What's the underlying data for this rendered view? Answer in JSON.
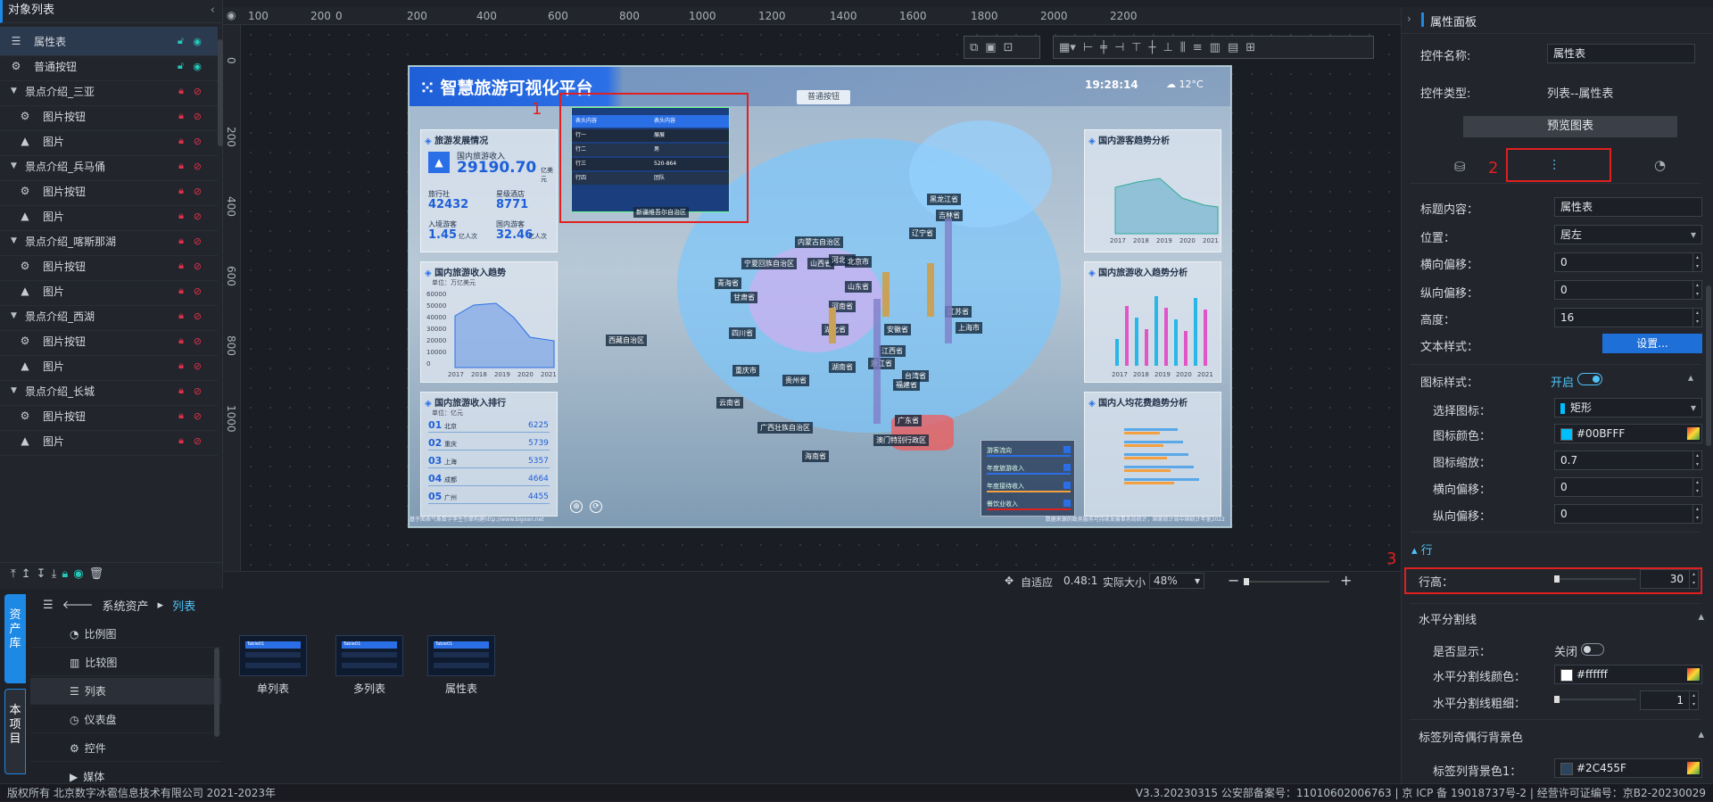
{
  "left_panel": {
    "title": "对象列表",
    "items": [
      {
        "label": "属性表",
        "type": "table",
        "lock": "unlocked",
        "eye": "visible",
        "indent": 0,
        "selected": true
      },
      {
        "label": "普通按钮",
        "type": "gear",
        "lock": "unlocked",
        "eye": "visible",
        "indent": 0
      },
      {
        "label": "景点介绍_三亚",
        "type": "group",
        "indent": 0
      },
      {
        "label": "图片按钮",
        "type": "gear",
        "indent": 1
      },
      {
        "label": "图片",
        "type": "image",
        "indent": 1
      },
      {
        "label": "景点介绍_兵马俑",
        "type": "group",
        "indent": 0
      },
      {
        "label": "图片按钮",
        "type": "gear",
        "indent": 1
      },
      {
        "label": "图片",
        "type": "image",
        "indent": 1
      },
      {
        "label": "景点介绍_喀斯那湖",
        "type": "group",
        "indent": 0
      },
      {
        "label": "图片按钮",
        "type": "gear",
        "indent": 1
      },
      {
        "label": "图片",
        "type": "image",
        "indent": 1
      },
      {
        "label": "景点介绍_西湖",
        "type": "group",
        "indent": 0
      },
      {
        "label": "图片按钮",
        "type": "gear",
        "indent": 1
      },
      {
        "label": "图片",
        "type": "image",
        "indent": 1
      },
      {
        "label": "景点介绍_长城",
        "type": "group",
        "indent": 0
      },
      {
        "label": "图片按钮",
        "type": "gear",
        "indent": 1
      },
      {
        "label": "图片",
        "type": "image",
        "indent": 1
      }
    ]
  },
  "ruler": {
    "top": [
      "100",
      "200",
      "0",
      "200",
      "400",
      "600",
      "800",
      "1000",
      "1200",
      "1400",
      "1600",
      "1800",
      "2000",
      "2200"
    ],
    "left": [
      "0",
      "200",
      "400",
      "600",
      "800",
      "1000"
    ]
  },
  "dashboard": {
    "title": "智慧旅游可视化平台",
    "clock": "19:28:14",
    "weather": "12°C",
    "pill": "普通按钮",
    "cards": {
      "dev": "旅游发展情况",
      "income_label": "国内旅游收入",
      "income": "29190.70",
      "income_unit": "亿美元",
      "k1_label": "旅行社",
      "k1": "42432",
      "k2_label": "星级酒店",
      "k2": "8771",
      "k3_label": "入境游客",
      "k3": "1.45",
      "k3_unit": "亿人次",
      "k4_label": "国内游客",
      "k4": "32.46",
      "k4_unit": "亿人次",
      "trend": "国内旅游收入趋势",
      "trend_unit": "单位：万亿美元",
      "rank": "国内旅游收入排行",
      "rank_unit": "单位：亿元",
      "rank_items": [
        {
          "n": "01",
          "c": "北京",
          "v": "6225"
        },
        {
          "n": "02",
          "c": "重庆",
          "v": "5739"
        },
        {
          "n": "03",
          "c": "上海",
          "v": "5357"
        },
        {
          "n": "04",
          "c": "成都",
          "v": "4664"
        },
        {
          "n": "05",
          "c": "广州",
          "v": "4455"
        }
      ],
      "r1": "国内游客趋势分析",
      "r2": "国内旅游收入趋势分析",
      "r3": "国内人均花费趋势分析",
      "legend_items": [
        "游客流向",
        "年度旅游收入",
        "年度接待收入",
        "餐饮业收入"
      ]
    },
    "years": [
      "2017",
      "2018",
      "2019",
      "2020",
      "2021"
    ],
    "income_trend_yticks": [
      "60000",
      "50000",
      "40000",
      "30000",
      "20000",
      "10000",
      "0"
    ],
    "map_labels": [
      "西藏自治区",
      "四川省",
      "重庆市",
      "云南省",
      "青海省",
      "甘肃省",
      "宁夏回族自治区",
      "内蒙古自治区",
      "山西省",
      "河北省",
      "北京市",
      "山东省",
      "河南省",
      "湖北省",
      "安徽省",
      "江西省",
      "浙江省",
      "福建省",
      "台湾省",
      "广西壮族自治区",
      "广东省",
      "澳门特别行政区",
      "海南省",
      "黑龙江省",
      "吉林省",
      "辽宁省",
      "上海市",
      "贵州省",
      "湖南省",
      "江苏省",
      "新疆维吾尔自治区"
    ],
    "mini_table": {
      "header": [
        "表头内容",
        "表头内容"
      ],
      "rows": [
        [
          "行一",
          "展展"
        ],
        [
          "行二",
          "男"
        ],
        [
          "行三",
          "520-864"
        ],
        [
          "行四",
          "团队"
        ]
      ]
    },
    "footer_left": "基于图表气象数字孪生引擎构建http://www.bigoan.net",
    "footer_right": "数据来源的政务服务可持续发展事务局统计，国家统计局中国统计年鉴2022"
  },
  "annotations": [
    "1",
    "2",
    "3"
  ],
  "zoom_bar": {
    "fit": "自适应",
    "ratio": "0.48:1",
    "actual": "实际大小",
    "zoom": "48%"
  },
  "asset": {
    "tabs": [
      "资产库",
      "本项目"
    ],
    "breadcrumb": {
      "root": "系统资产",
      "current": "列表"
    },
    "categories": [
      "比例图",
      "比较图",
      "列表",
      "仪表盘",
      "控件",
      "媒体"
    ],
    "thumbs": [
      {
        "label": "单列表",
        "header": "Table01"
      },
      {
        "label": "多列表",
        "header": "Table01"
      },
      {
        "label": "属性表",
        "header": "Table01"
      }
    ]
  },
  "right_panel": {
    "title": "属性面板",
    "name_label": "控件名称:",
    "name_value": "属性表",
    "type_label": "控件类型:",
    "type_value": "列表--属性表",
    "preview": "预览图表",
    "title_content_label": "标题内容：",
    "title_content": "属性表",
    "pos_label": "位置：",
    "pos_value": "居左",
    "h_offset_label": "横向偏移：",
    "h_offset": "0",
    "v_offset_label": "纵向偏移：",
    "v_offset": "0",
    "height_label": "高度：",
    "height": "16",
    "text_style_label": "文本样式：",
    "text_style_btn": "设置...",
    "icon_style_label": "图标样式：",
    "icon_style_state": "开启",
    "pick_icon_label": "选择图标：",
    "pick_icon": "矩形",
    "icon_color_label": "图标颜色：",
    "icon_color": "#00BFFF",
    "icon_scale_label": "图标缩放：",
    "icon_scale": "0.7",
    "icon_h_label": "横向偏移：",
    "icon_h": "0",
    "icon_v_label": "纵向偏移：",
    "icon_v": "0",
    "row_section": "行",
    "row_height_label": "行高：",
    "row_height": "30",
    "hline_section": "水平分割线",
    "show_label": "是否显示：",
    "show_state": "关闭",
    "hline_color_label": "水平分割线颜色：",
    "hline_color": "#ffffff",
    "hline_width_label": "水平分割线粗细：",
    "hline_width": "1",
    "odd_even_section": "标签列奇偶行背景色",
    "bg1_label": "标签列背景色1：",
    "bg1": "#2C455F"
  },
  "footer": {
    "left": "版权所有 北京数字冰雹信息技术有限公司 2021-2023年",
    "right": "V3.3.20230315 公安部备案号：11010602006763 | 京 ICP 备 19018737号-2 | 经营许可证编号：京B2-20230029"
  },
  "colors": {
    "accent": "#1e88e5",
    "danger": "#e02020",
    "teal": "#25c7b8"
  }
}
